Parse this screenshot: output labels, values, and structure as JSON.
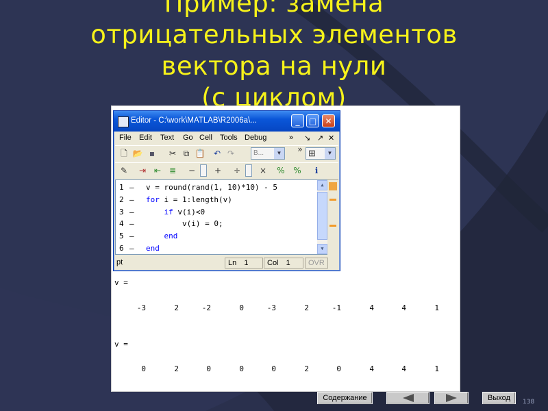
{
  "slide": {
    "title_lines": [
      "Пример: замена",
      "отрицательных элементов",
      "вектора на нули",
      "(с циклом)"
    ],
    "page_number": "138",
    "colors": {
      "background": "#2b3150",
      "title": "#f6f21a",
      "accent_arc": "#1b1f33"
    }
  },
  "editor": {
    "window_title": "Editor - C:\\work\\MATLAB\\R2006a\\...",
    "menu": [
      "File",
      "Edit",
      "Text",
      "Go",
      "Cell",
      "Tools",
      "Debug"
    ],
    "toolbar_overflow": "»",
    "combo_value": "B...",
    "toolbar2_minus": "−",
    "toolbar2_plus": "+",
    "toolbar2_div": "÷",
    "toolbar2_times": "×",
    "lines": [
      {
        "n": "1",
        "code": "v = round(rand(1, 10)*10) - 5"
      },
      {
        "n": "2",
        "kw": "for",
        "code": " i = 1:length(v)"
      },
      {
        "n": "3",
        "indent": "    ",
        "kw": "if",
        "code": " v(i)<0"
      },
      {
        "n": "4",
        "code": "        v(i) = 0;"
      },
      {
        "n": "5",
        "indent": "    ",
        "kw": "end",
        "code": ""
      },
      {
        "n": "6",
        "kw": "end",
        "code": ""
      }
    ],
    "status": {
      "mode": "pt",
      "ln_label": "Ln",
      "ln": "1",
      "col_label": "Col",
      "col": "1",
      "ovr": "OVR"
    }
  },
  "output": {
    "label1": "v =",
    "values1": [
      "-3",
      "2",
      "-2",
      "0",
      "-3",
      "2",
      "-1",
      "4",
      "4",
      "1"
    ],
    "label2": "v =",
    "values2": [
      "0",
      "2",
      "0",
      "0",
      "0",
      "2",
      "0",
      "4",
      "4",
      "1"
    ]
  },
  "nav": {
    "contents": "Содержание",
    "prev_icon": "left-triangle-icon",
    "next_icon": "right-triangle-icon",
    "exit": "Выход"
  }
}
